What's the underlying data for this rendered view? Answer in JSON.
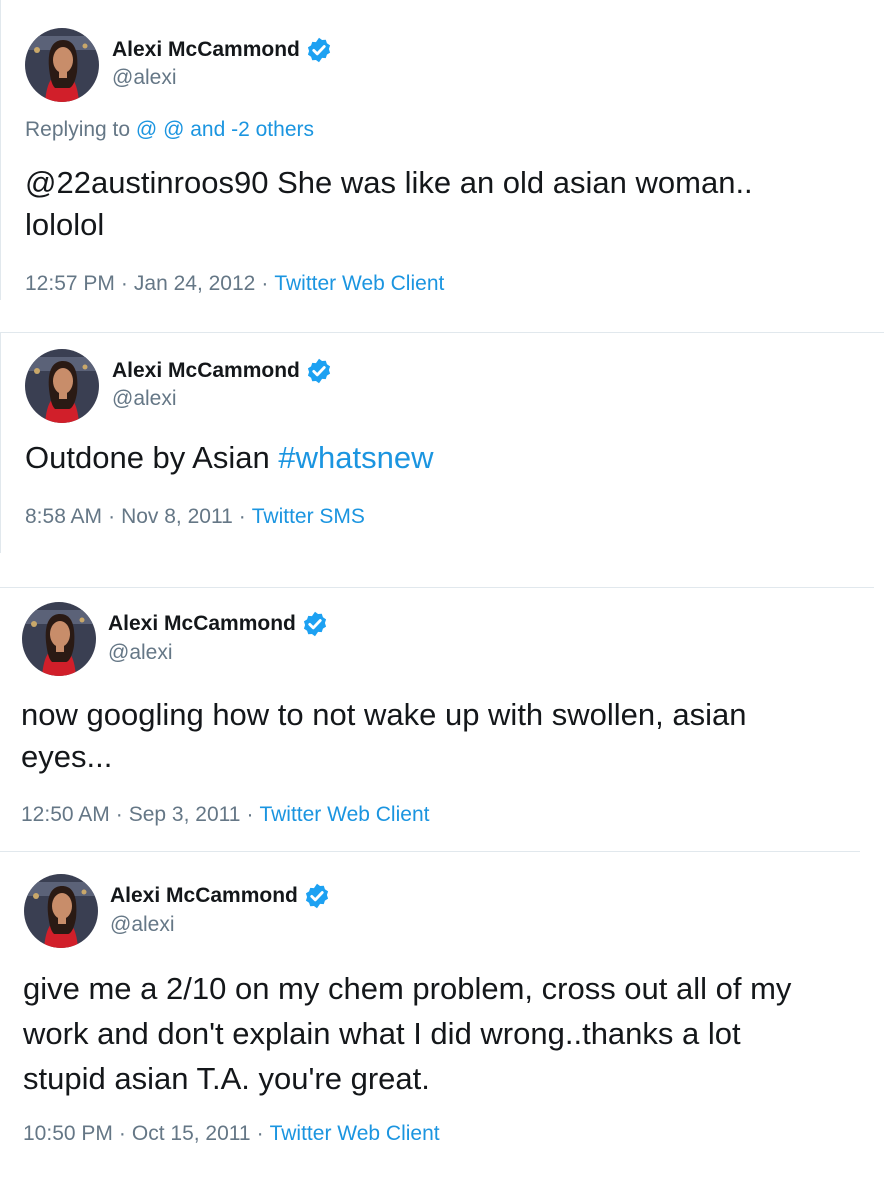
{
  "colors": {
    "link": "#1b95e0",
    "secondary": "#657786",
    "primary": "#14171a",
    "divider": "#e1e8ed"
  },
  "tweets": [
    {
      "author": {
        "name": "Alexi McCammond",
        "handle": "@alexi",
        "verified_icon": "verified-badge-icon",
        "avatar_icon": "profile-photo"
      },
      "reply": {
        "prefix": "Replying to",
        "m1": "@",
        "m2": "@",
        "suffix": "and -2 others"
      },
      "text_line1": "@22austinroos90 She was like an old asian woman..",
      "text_line2": "lololol",
      "time": "12:57 PM",
      "date": "Jan 24, 2012",
      "source": "Twitter Web Client"
    },
    {
      "author": {
        "name": "Alexi McCammond",
        "handle": "@alexi",
        "verified_icon": "verified-badge-icon",
        "avatar_icon": "profile-photo"
      },
      "text_plain": "Outdone by Asian",
      "hashtag": "#whatsnew",
      "time": "8:58 AM",
      "date": "Nov 8, 2011",
      "source": "Twitter SMS"
    },
    {
      "author": {
        "name": "Alexi McCammond",
        "handle": "@alexi",
        "verified_icon": "verified-badge-icon",
        "avatar_icon": "profile-photo"
      },
      "text_line1": "now googling how to not wake up with swollen, asian",
      "text_line2": "eyes...",
      "time": "12:50 AM",
      "date": "Sep 3, 2011",
      "source": "Twitter Web Client"
    },
    {
      "author": {
        "name": "Alexi McCammond",
        "handle": "@alexi",
        "verified_icon": "verified-badge-icon",
        "avatar_icon": "profile-photo"
      },
      "text_line1": "give me a 2/10 on my chem problem, cross out all of my",
      "text_line2": "work and don't explain what I did wrong..thanks a lot",
      "text_line3": "stupid asian T.A. you're great.",
      "time": "10:50 PM",
      "date": "Oct 15, 2011",
      "source": "Twitter Web Client"
    }
  ]
}
